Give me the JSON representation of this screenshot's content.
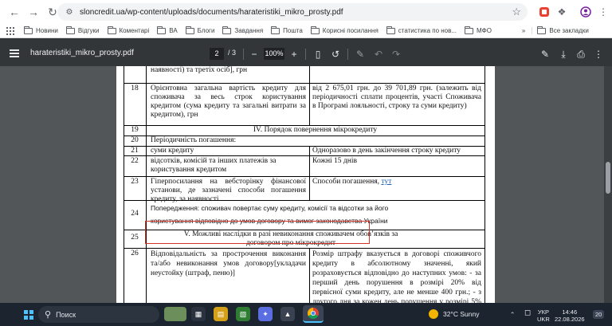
{
  "browser": {
    "url": "sloncredit.ua/wp-content/uploads/documents/harateristiki_mikro_prosty.pdf"
  },
  "bookmarks": {
    "items": [
      "Новини",
      "Відгуки",
      "Коментарі",
      "ВА",
      "Блоги",
      "Завдання",
      "Пошта",
      "Корисні посилання",
      "статистика по нов...",
      "МФО"
    ],
    "overflow": "»",
    "all": "Все закладки"
  },
  "pdf": {
    "filename": "harateristiki_mikro_prosty.pdf",
    "page_current": "2",
    "page_sep": "/ 3",
    "zoom": "100%",
    "minus": "−",
    "plus": "+"
  },
  "table": {
    "top_fragment": "наявності) та третіх осіб], грн",
    "row18": {
      "num": "18",
      "left": "Орієнтовна загальна вартість кредиту для споживача за весь строк користування кредитом (сума кредиту та загальні витрати за кредитом), грн",
      "right": "від 2 675,01 грн. до 39 701,89 грн. (залежить від періодичності сплати процентів, участі Споживача в Програмі лояльності, строку та суми кредиту)"
    },
    "row19": {
      "num": "19",
      "text": "IV. Порядок повернення мікрокредиту"
    },
    "row20": {
      "num": "20",
      "text": "Періодичність погашення:"
    },
    "row21": {
      "num": "21",
      "left": "суми кредиту",
      "right": "Одноразово в день закінчення строку кредиту"
    },
    "row22": {
      "num": "22",
      "left": "відсотків, комісій та інших платежів за користування кредитом",
      "right": "Кожні 15 днів"
    },
    "row23": {
      "num": "23",
      "left": "Гіперпосилання на вебсторінку фінансової установи, де зазначені способи погашення кредиту, за наявності",
      "right": "Способи погашення,",
      "link": "тут"
    },
    "row24": {
      "num": "24",
      "text": "Попередження: споживач повертає суму кредиту, комісії та відсотки за його користування відповідно до умов договору та вимог законодавства України"
    },
    "row25": {
      "num": "25",
      "text": "V. Можливі наслідки в разі невиконання споживачем обов’язків за договором про мікрокредит"
    },
    "row26": {
      "num": "26",
      "left": "Відповідальність за прострочення виконання та/або невиконання умов договору[укладачи неустойку (штраф, пеню)]",
      "right": "Розмір штрафу вказується в договорі споживчого кредиту в абсолютному значенні, який розраховується відповідно до наступних умов: - за перший день порушення в розмірі 20% від первісної суми кредиту, але не менше 400 грн.; - з другого дня за кожен день порушення у розмірі 5% від первісної суми кредиту, але не"
    }
  },
  "taskbar": {
    "search_label": "Поиск",
    "weather": "32°C  Sunny",
    "lang_top": "УКР",
    "lang_bottom": "UKR",
    "time": "14:46",
    "date": "22.08.2026",
    "notifications": "20"
  },
  "colors": {
    "highlight_border": "#d93025",
    "link": "#1a5fb4"
  }
}
